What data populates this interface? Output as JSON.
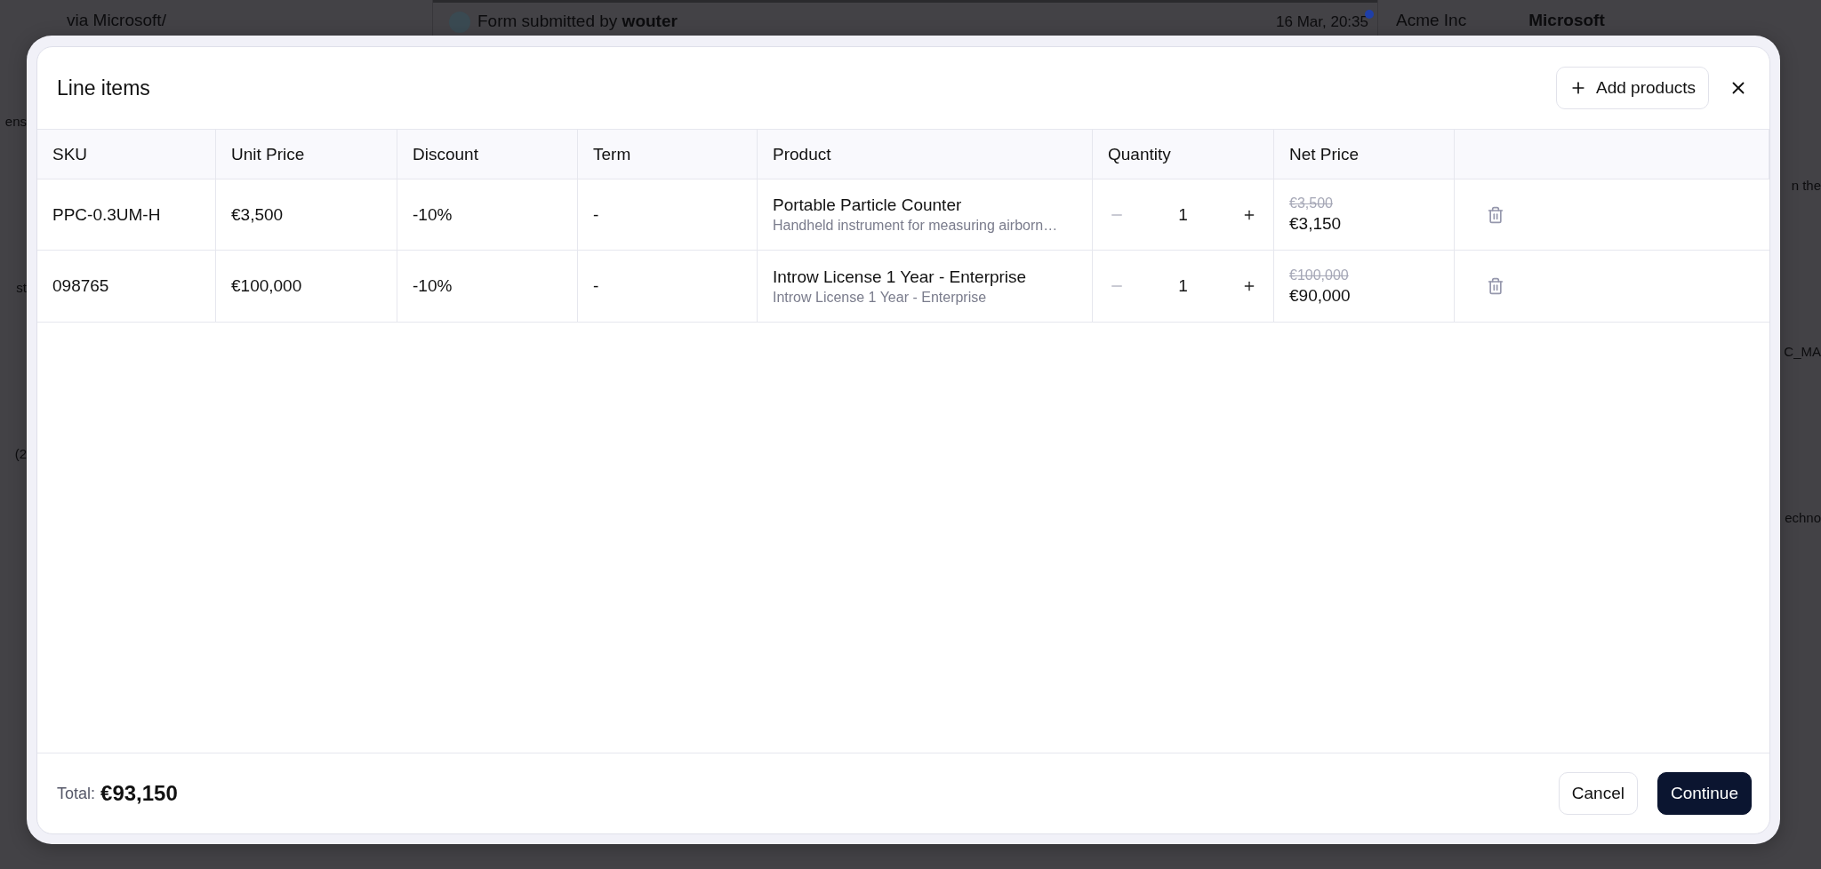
{
  "background": {
    "top_bar": {
      "source": "via Microsoft/",
      "activity": "Form submitted by **wouter**",
      "time": "16 Mar, 20:35",
      "unread": true,
      "company_label": "Acme Inc",
      "company_value": "Microsoft"
    },
    "left_fragments": [
      "ens",
      "st",
      "(2"
    ],
    "right_fragments": [
      "n the",
      "C_MA",
      "echno"
    ]
  },
  "dialog": {
    "title": "Line items",
    "add_button": "Add products",
    "columns": [
      "SKU",
      "Unit Price",
      "Discount",
      "Term",
      "Product",
      "Quantity",
      "Net Price"
    ],
    "rows": [
      {
        "sku": "PPC-0.3UM-H",
        "unit_price": "€3,500",
        "discount": "-10%",
        "term": "-",
        "product": "Portable Particle Counter",
        "description": "Handheld instrument for measuring airborn…",
        "quantity": "1",
        "decrement_disabled": true,
        "original_price": "€3,500",
        "net_price": "€3,150"
      },
      {
        "sku": "098765",
        "unit_price": "€100,000",
        "discount": "-10%",
        "term": "-",
        "product": "Introw License 1 Year - Enterprise",
        "description": "Introw License 1 Year - Enterprise",
        "quantity": "1",
        "decrement_disabled": true,
        "original_price": "€100,000",
        "net_price": "€90,000"
      }
    ],
    "total_label": "Total:",
    "total": "€93,150",
    "buttons": [
      {
        "label": "Cancel",
        "kind": "secondary"
      },
      {
        "label": "Continue",
        "kind": "primary"
      }
    ]
  }
}
